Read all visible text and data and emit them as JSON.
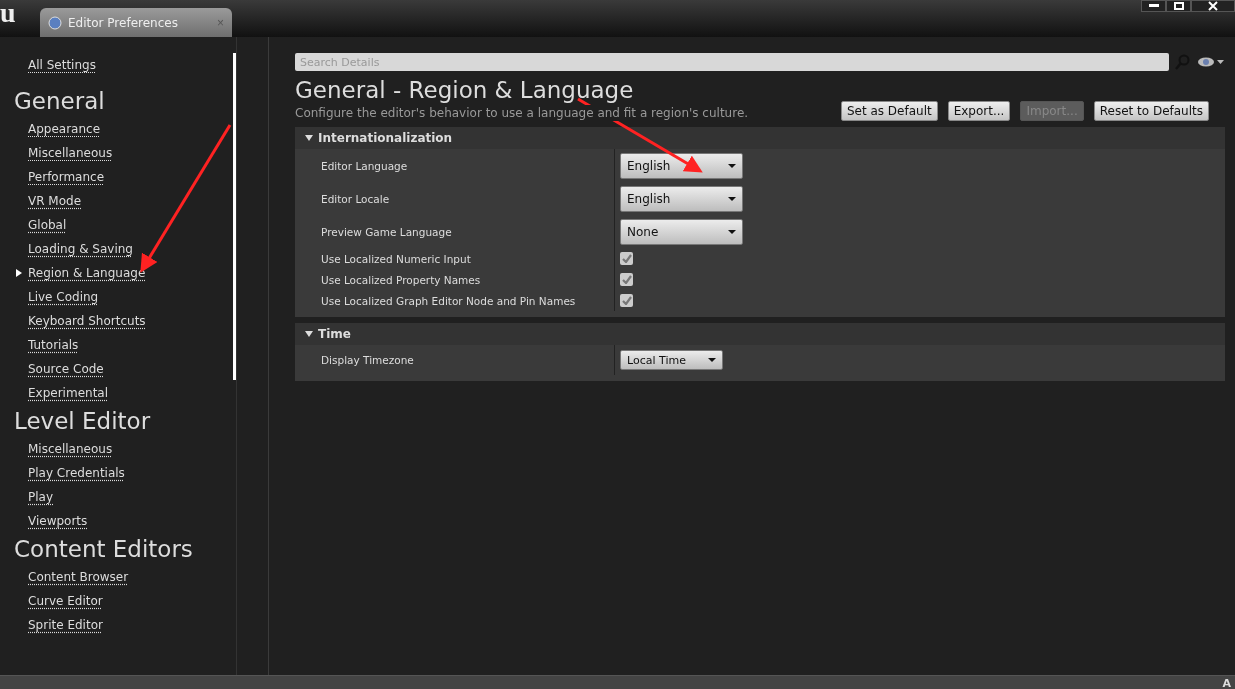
{
  "window": {
    "logo": "u",
    "tab": {
      "title": "Editor Preferences",
      "close": "×"
    }
  },
  "sidebar": {
    "all_settings": "All Settings",
    "sections": [
      {
        "title": "General",
        "items": [
          {
            "label": "Appearance",
            "selected": false
          },
          {
            "label": "Miscellaneous",
            "selected": false
          },
          {
            "label": "Performance",
            "selected": false
          },
          {
            "label": "VR Mode",
            "selected": false
          },
          {
            "label": "Global",
            "selected": false
          },
          {
            "label": "Loading & Saving",
            "selected": false
          },
          {
            "label": "Region & Language",
            "selected": true
          },
          {
            "label": "Live Coding",
            "selected": false
          },
          {
            "label": "Keyboard Shortcuts",
            "selected": false
          },
          {
            "label": "Tutorials",
            "selected": false
          },
          {
            "label": "Source Code",
            "selected": false
          },
          {
            "label": "Experimental",
            "selected": false
          }
        ]
      },
      {
        "title": "Level Editor",
        "items": [
          {
            "label": "Miscellaneous",
            "selected": false
          },
          {
            "label": "Play Credentials",
            "selected": false
          },
          {
            "label": "Play",
            "selected": false
          },
          {
            "label": "Viewports",
            "selected": false
          }
        ]
      },
      {
        "title": "Content Editors",
        "items": [
          {
            "label": "Content Browser",
            "selected": false
          },
          {
            "label": "Curve Editor",
            "selected": false
          },
          {
            "label": "Sprite Editor",
            "selected": false
          }
        ]
      }
    ]
  },
  "details": {
    "search": {
      "placeholder": "Search Details"
    },
    "title": "General - Region & Language",
    "description": "Configure the editor's behavior to use a language and fit a region's culture.",
    "buttons": [
      {
        "label": "Set as Default",
        "disabled": false
      },
      {
        "label": "Export...",
        "disabled": false
      },
      {
        "label": "Import...",
        "disabled": true
      },
      {
        "label": "Reset to Defaults",
        "disabled": false
      }
    ],
    "categories": [
      {
        "title": "Internationalization",
        "expanded": true,
        "rows": [
          {
            "label": "Editor Language",
            "kind": "dropdown",
            "value": "English"
          },
          {
            "label": "Editor Locale",
            "kind": "dropdown",
            "value": "English"
          },
          {
            "label": "Preview Game Language",
            "kind": "dropdown",
            "value": "None"
          },
          {
            "label": "Use Localized Numeric Input",
            "kind": "checkbox",
            "checked": true
          },
          {
            "label": "Use Localized Property Names",
            "kind": "checkbox",
            "checked": true
          },
          {
            "label": "Use Localized Graph Editor Node and Pin Names",
            "kind": "checkbox",
            "checked": true
          }
        ]
      },
      {
        "title": "Time",
        "expanded": true,
        "rows": [
          {
            "label": "Display Timezone",
            "kind": "small-dropdown",
            "value": "Local Time"
          }
        ]
      }
    ]
  },
  "status_bar": {
    "text": "A"
  }
}
